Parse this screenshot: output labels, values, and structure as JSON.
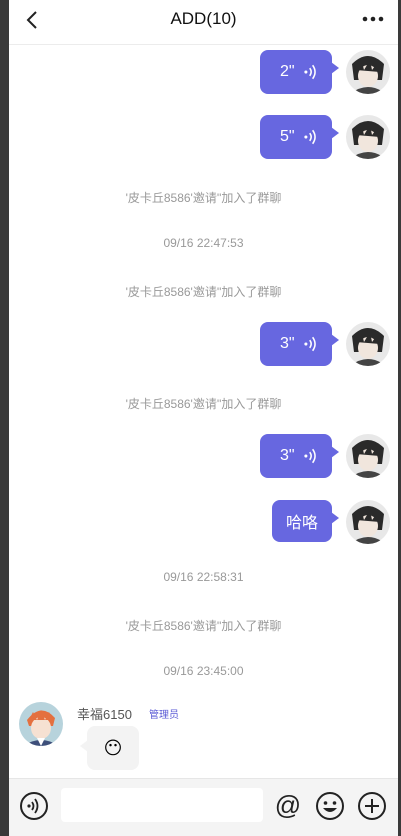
{
  "header": {
    "title": "ADD(10)"
  },
  "icons": {
    "back": "chevron-left-icon",
    "more": "more-dots-icon",
    "voice_wave": "voice-wave-icon",
    "voice_input": "voice-input-icon",
    "mention": "at-icon",
    "emoji": "emoji-icon",
    "plus": "plus-icon"
  },
  "messages": {
    "m1": "2\"",
    "m2": "5\"",
    "sys1": "'皮卡丘8586'邀请''加入了群聊",
    "time1": "09/16 22:47:53",
    "sys2": "'皮卡丘8586'邀请''加入了群聊",
    "m3": "3\"",
    "sys3": "'皮卡丘8586'邀请''加入了群聊",
    "m4": "3\"",
    "m5": "哈咯",
    "time2": "09/16 22:58:31",
    "sys4": "'皮卡丘8586'邀请''加入了群聊",
    "time3": "09/16 23:45:00"
  },
  "incoming": {
    "sender": "幸福6150",
    "badge": "管理员",
    "content": "😶"
  },
  "colors": {
    "accent": "#6767e0",
    "badge": "#5b5bd6"
  },
  "input": {
    "value": ""
  }
}
